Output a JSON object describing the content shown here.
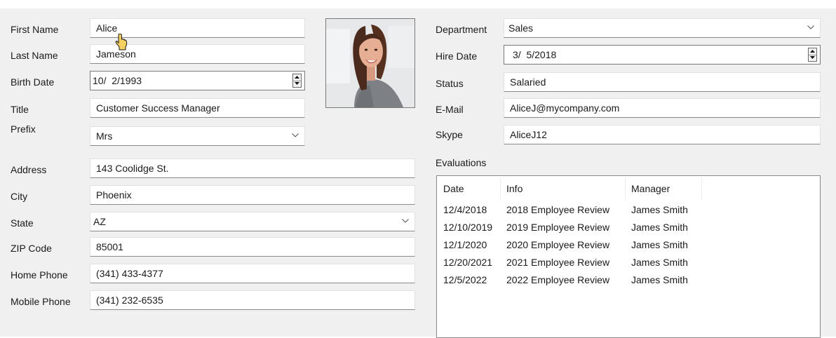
{
  "personal": {
    "first_name": {
      "label": "First Name",
      "value": "Alice"
    },
    "last_name": {
      "label": "Last Name",
      "value": "Jameson"
    },
    "birth_date": {
      "label": "Birth Date",
      "value": "10/  2/1993"
    },
    "title": {
      "label": "Title",
      "value": "Customer Success Manager"
    },
    "prefix": {
      "label": "Prefix",
      "value": "Mrs"
    }
  },
  "address": {
    "address": {
      "label": "Address",
      "value": "143 Coolidge St."
    },
    "city": {
      "label": "City",
      "value": "Phoenix"
    },
    "state": {
      "label": "State",
      "value": "AZ"
    },
    "zip": {
      "label": "ZIP Code",
      "value": "85001"
    },
    "home_phone": {
      "label": "Home Phone",
      "value": "(341) 433-4377"
    },
    "mobile_phone": {
      "label": "Mobile Phone",
      "value": "(341) 232-6535"
    }
  },
  "employment": {
    "department": {
      "label": "Department",
      "value": "Sales"
    },
    "hire_date": {
      "label": "Hire Date",
      "value": "3/  5/2018"
    },
    "status": {
      "label": "Status",
      "value": "Salaried"
    },
    "email": {
      "label": "E-Mail",
      "value": "AliceJ@mycompany.com"
    },
    "skype": {
      "label": "Skype",
      "value": "AliceJ12"
    }
  },
  "evaluations": {
    "label": "Evaluations",
    "columns": [
      "Date",
      "Info",
      "Manager"
    ],
    "rows": [
      [
        "12/4/2018",
        "2018 Employee Review",
        "James Smith"
      ],
      [
        "12/10/2019",
        "2019 Employee Review",
        "James Smith"
      ],
      [
        "12/1/2020",
        "2020 Employee Review",
        "James Smith"
      ],
      [
        "12/20/2021",
        "2021 Employee Review",
        "James Smith"
      ],
      [
        "12/5/2022",
        "2022 Employee Review",
        "James Smith"
      ]
    ]
  },
  "icons": {
    "dropdown": "chevron-down-icon",
    "spin_up": "spin-up-arrow-icon",
    "spin_down": "spin-down-arrow-icon",
    "pointer": "mouse-pointer-icon"
  },
  "colors": {
    "form_background": "#f0f0f0",
    "field_background": "#ffffff",
    "field_border": "#8a8a8a",
    "cursor_fill": "#f5d061"
  }
}
